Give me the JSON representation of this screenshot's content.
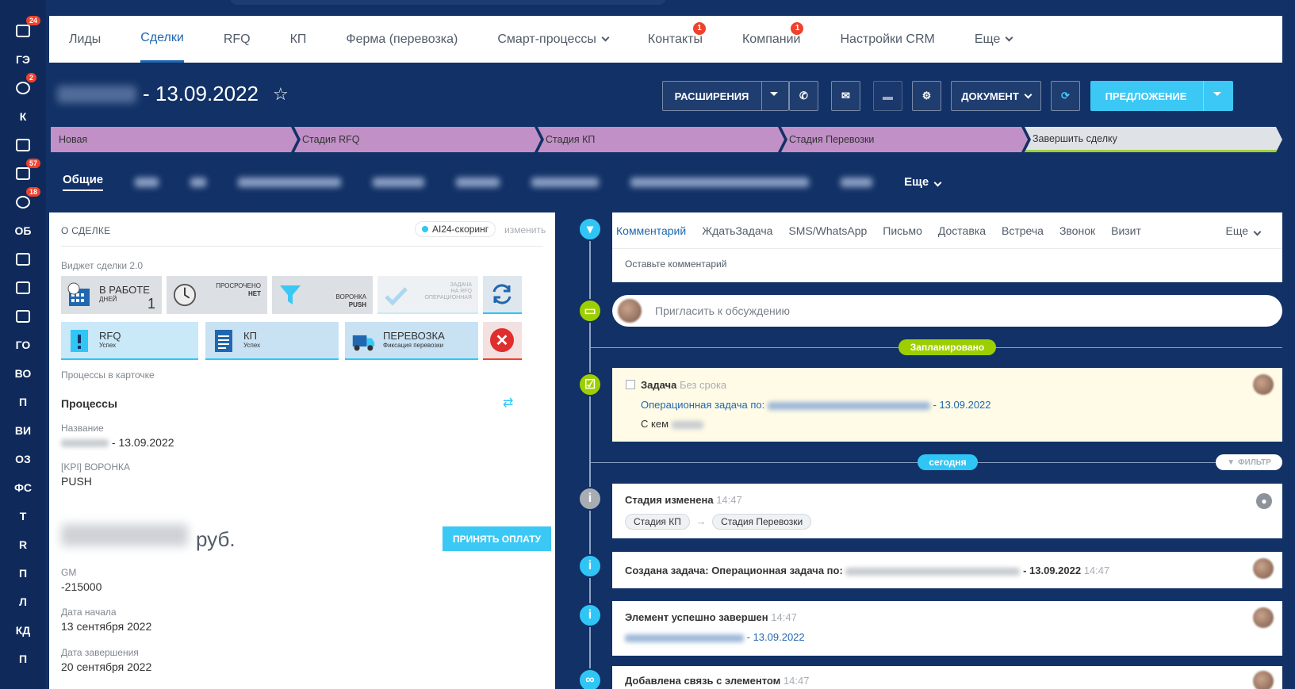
{
  "rail": {
    "items": [
      {
        "label": "",
        "icon": "calendar-list-icon",
        "badge": "24"
      },
      {
        "label": "ГЭ",
        "icon": "",
        "badge": ""
      },
      {
        "label": "",
        "icon": "filter-icon",
        "badge": "2"
      },
      {
        "label": "К",
        "icon": "",
        "badge": ""
      },
      {
        "label": "",
        "icon": "calendar-icon",
        "badge": ""
      },
      {
        "label": "",
        "icon": "tasks-icon",
        "badge": "57"
      },
      {
        "label": "",
        "icon": "robot-icon",
        "badge": "18"
      },
      {
        "label": "ОБ",
        "icon": "",
        "badge": ""
      },
      {
        "label": "",
        "icon": "contact-card-icon",
        "badge": ""
      },
      {
        "label": "",
        "icon": "users-icon",
        "badge": ""
      },
      {
        "label": "",
        "icon": "drive-icon",
        "badge": ""
      },
      {
        "label": "ГО",
        "icon": "",
        "badge": ""
      },
      {
        "label": "ВО",
        "icon": "",
        "badge": ""
      },
      {
        "label": "П",
        "icon": "",
        "badge": ""
      },
      {
        "label": "ВИ",
        "icon": "",
        "badge": ""
      },
      {
        "label": "ОЗ",
        "icon": "",
        "badge": ""
      },
      {
        "label": "ФС",
        "icon": "",
        "badge": ""
      },
      {
        "label": "Т",
        "icon": "",
        "badge": ""
      },
      {
        "label": "R",
        "icon": "",
        "badge": ""
      },
      {
        "label": "П",
        "icon": "",
        "badge": ""
      },
      {
        "label": "Л",
        "icon": "",
        "badge": ""
      },
      {
        "label": "КД",
        "icon": "",
        "badge": ""
      },
      {
        "label": "П",
        "icon": "",
        "badge": ""
      }
    ]
  },
  "crm_menu": {
    "items": [
      {
        "label": "Лиды",
        "active": false,
        "badge": "",
        "dropdown": false
      },
      {
        "label": "Сделки",
        "active": true,
        "badge": "",
        "dropdown": false
      },
      {
        "label": "RFQ",
        "active": false,
        "badge": "",
        "dropdown": false
      },
      {
        "label": "КП",
        "active": false,
        "badge": "",
        "dropdown": false
      },
      {
        "label": "Ферма (перевозка)",
        "active": false,
        "badge": "",
        "dropdown": false
      },
      {
        "label": "Смарт-процессы",
        "active": false,
        "badge": "",
        "dropdown": true
      },
      {
        "label": "Контакты",
        "active": false,
        "badge": "1",
        "dropdown": false
      },
      {
        "label": "Компании",
        "active": false,
        "badge": "1",
        "dropdown": false
      },
      {
        "label": "Настройки CRM",
        "active": false,
        "badge": "",
        "dropdown": false
      },
      {
        "label": "Еще",
        "active": false,
        "badge": "",
        "dropdown": true
      }
    ]
  },
  "deal": {
    "title_suffix": "- 13.09.2022",
    "star_icon": "star-icon"
  },
  "toolbar": {
    "extensions": "РАСШИРЕНИЯ",
    "document": "ДОКУМЕНТ",
    "offer": "ПРЕДЛОЖЕНИЕ"
  },
  "stages": [
    {
      "label": "Новая"
    },
    {
      "label": "Стадия RFQ"
    },
    {
      "label": "Стадия КП"
    },
    {
      "label": "Стадия Перевозки"
    },
    {
      "label": "Завершить сделку"
    }
  ],
  "tabs": {
    "active": "Общие",
    "more": "Еще"
  },
  "about": {
    "header": "О СДЕЛКЕ",
    "scoring": "AI24-скоринг",
    "change": "изменить",
    "widget_title": "Виджет сделки 2.0",
    "tiles": {
      "work_main": "В РАБОТЕ",
      "work_sub": "ДНЕЙ",
      "work_value": "1",
      "overdue_main": "ПРОСРОЧЕНО",
      "overdue_sub": "НЕТ",
      "funnel_main": "ВОРОНКА",
      "funnel_sub": "PUSH",
      "task_line1": "ЗАДАЧА",
      "task_line2": "НА RFQ",
      "task_line3": "ОПЕРАЦИОННАЯ",
      "rfq_main": "RFQ",
      "rfq_sub": "Успех",
      "kp_main": "КП",
      "kp_sub": "Успех",
      "transport_main": "ПЕРЕВОЗКА",
      "transport_sub": "Фиксация перевозки"
    },
    "processes_in_card": "Процессы в карточке",
    "processes_title": "Процессы",
    "name_label": "Название",
    "name_value": "- 13.09.2022",
    "kpi_label": "[KPI] ВОРОНКА",
    "kpi_value": "PUSH",
    "currency": "руб.",
    "accept_payment": "ПРИНЯТЬ ОПЛАТУ",
    "gm_label": "GM",
    "gm_value": "-215000",
    "start_label": "Дата начала",
    "start_value": "13 сентября 2022",
    "end_label": "Дата завершения",
    "end_value": "20 сентября 2022"
  },
  "editor": {
    "tabs": [
      "Комментарий",
      "Ждать",
      "Задача",
      "SMS/WhatsApp",
      "Письмо",
      "Доставка",
      "Встреча",
      "Звонок",
      "Визит"
    ],
    "more": "Еще",
    "placeholder": "Оставьте комментарий",
    "invite": "Пригласить к обсуждению"
  },
  "timeline": {
    "planned_pill": "Запланировано",
    "today_pill": "сегодня",
    "filter": "ФИЛЬТР",
    "task_title": "Задача",
    "task_deadline": "Без срока",
    "task_link_prefix": "Операционная задача по:",
    "task_link_suffix": "- 13.09.2022",
    "task_with": "С кем",
    "stage_changed": "Стадия изменена",
    "stage_changed_time": "14:47",
    "stage_from": "Стадия КП",
    "stage_to": "Стадия Перевозки",
    "task_created": "Создана задача: Операционная задача по:",
    "task_created_suffix": "- 13.09.2022",
    "task_created_time": "14:47",
    "element_done": "Элемент успешно завершен",
    "element_done_time": "14:47",
    "element_done_suffix": "- 13.09.2022",
    "link_added": "Добавлена связь с элементом",
    "link_added_time": "14:47"
  },
  "colors": {
    "background": "#123166",
    "accent": "#3bc8f5",
    "stage": "#c090c6",
    "link": "#2067b0",
    "badge": "#f0412c",
    "planned": "#9dcf00"
  }
}
